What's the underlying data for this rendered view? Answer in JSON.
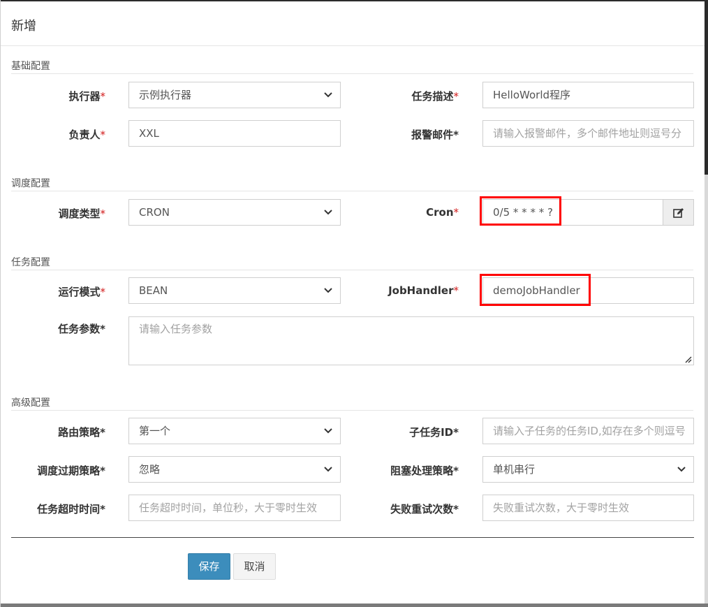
{
  "dialog": {
    "title": "新增"
  },
  "sections": {
    "basic": "基础配置",
    "schedule": "调度配置",
    "task": "任务配置",
    "advanced": "高级配置"
  },
  "fields": {
    "executor": {
      "label": "执行器",
      "star": "*",
      "value": "示例执行器"
    },
    "task_desc": {
      "label": "任务描述",
      "star": "*",
      "value": "HelloWorld程序"
    },
    "owner": {
      "label": "负责人",
      "star": "*",
      "value": "XXL"
    },
    "alarm_email": {
      "label": "报警邮件",
      "star": "*",
      "placeholder": "请输入报警邮件，多个邮件地址则逗号分"
    },
    "schedule_type": {
      "label": "调度类型",
      "star": "*",
      "value": "CRON"
    },
    "cron": {
      "label": "Cron",
      "star": "*",
      "value": "0/5 * * * * ?"
    },
    "run_mode": {
      "label": "运行模式",
      "star": "*",
      "value": "BEAN"
    },
    "job_handler": {
      "label": "JobHandler",
      "star": "*",
      "value": "demoJobHandler"
    },
    "task_param": {
      "label": "任务参数",
      "star": "*",
      "placeholder": "请输入任务参数"
    },
    "route_strategy": {
      "label": "路由策略",
      "star": "*",
      "value": "第一个"
    },
    "child_job_id": {
      "label": "子任务ID",
      "star": "*",
      "placeholder": "请输入子任务的任务ID,如存在多个则逗号"
    },
    "misfire_strategy": {
      "label": "调度过期策略",
      "star": "*",
      "value": "忽略"
    },
    "block_strategy": {
      "label": "阻塞处理策略",
      "star": "*",
      "value": "单机串行"
    },
    "timeout": {
      "label": "任务超时时间",
      "star": "*",
      "placeholder": "任务超时时间，单位秒，大于零时生效"
    },
    "retry_count": {
      "label": "失败重试次数",
      "star": "*",
      "placeholder": "失败重试次数，大于零时生效"
    }
  },
  "buttons": {
    "save": "保存",
    "cancel": "取消"
  },
  "icons": {
    "select": "chevron-down-icon",
    "cron_editor": "edit-icon"
  },
  "colors": {
    "required_star": "#d21c1c",
    "primary": "#3c8dbc",
    "highlight": "#ff0000"
  }
}
